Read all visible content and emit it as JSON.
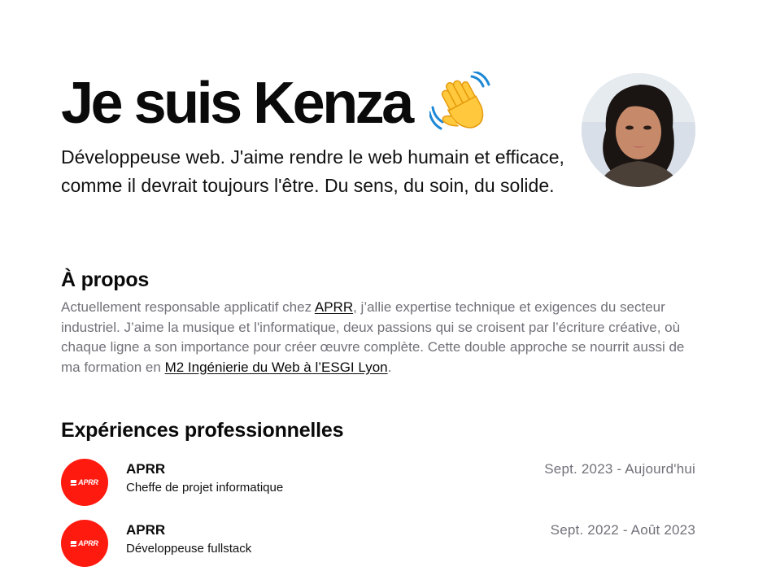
{
  "hero": {
    "title": "Je suis Kenza",
    "wave_icon": "waving-hand-emoji",
    "subtitle": "Développeuse web. J'aime rendre le web humain et efficace, comme il devrait toujours l'être. Du sens, du soin, du solide."
  },
  "about": {
    "title": "À propos",
    "text_1": "Actuellement responsable applicatif chez ",
    "link_company": "APRR",
    "text_2": ", j’allie expertise technique et exigences du secteur industriel. J’aime la musique et l'informatique, deux passions qui se croisent par l’écriture créative, où chaque ligne a son importance pour créer œuvre complète. Cette double approche se nourrit aussi de ma formation en ",
    "link_school": "M2 Ingénierie du Web à l’ESGI Lyon",
    "text_3": "."
  },
  "experiences": {
    "title": "Expériences professionnelles",
    "items": [
      {
        "logo_text": "APRR",
        "company": "APRR",
        "role": "Cheffe de projet informatique",
        "dates": "Sept. 2023 - Aujourd'hui"
      },
      {
        "logo_text": "APRR",
        "company": "APRR",
        "role": "Développeuse fullstack",
        "dates": "Sept. 2022 - Août 2023"
      }
    ]
  },
  "colors": {
    "text": "#0a0a0a",
    "muted": "#71717a",
    "logo_red": "#ff1a10",
    "wave_skin": "#ffc83d"
  }
}
